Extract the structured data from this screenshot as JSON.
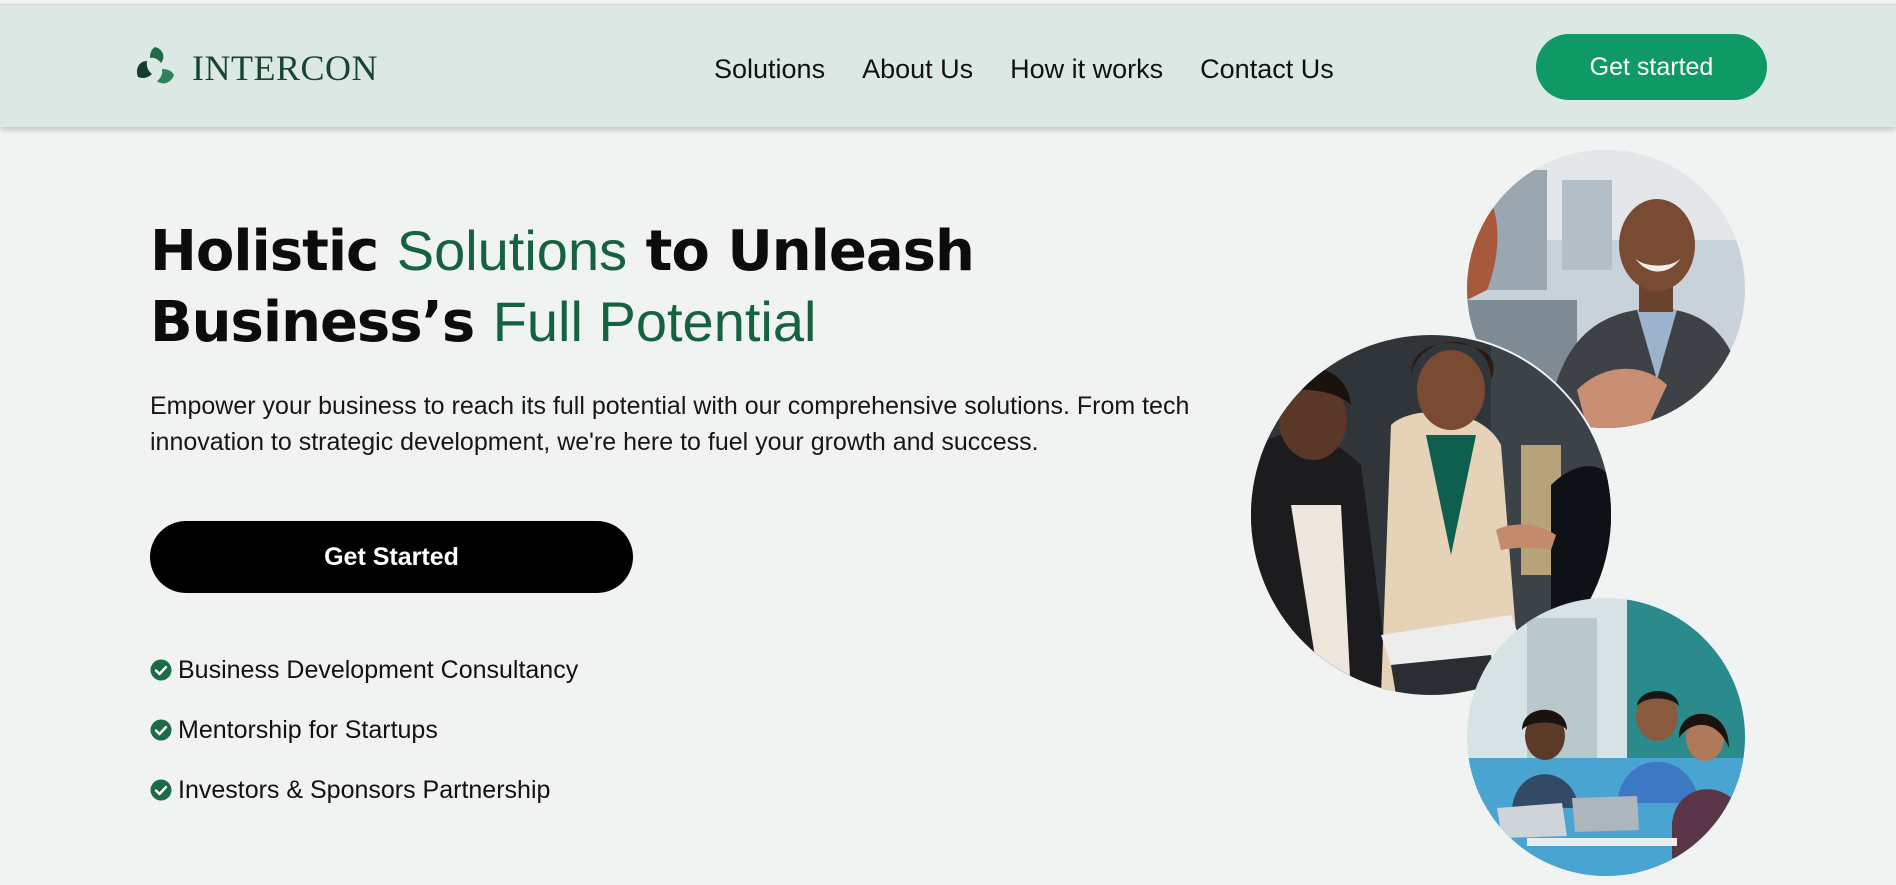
{
  "header": {
    "brand_name": "INTERCON",
    "logo_icon": "recycle-leaf-icon",
    "nav": [
      {
        "label": "Solutions"
      },
      {
        "label": "About Us"
      },
      {
        "label": "How it works"
      },
      {
        "label": "Contact Us"
      }
    ],
    "cta_label": "Get started"
  },
  "hero": {
    "title_part1": "Holistic ",
    "title_highlight1": "Solutions",
    "title_part2": " to Unleash Business’s ",
    "title_highlight2": "Full Potential",
    "description": "Empower your business to reach its full potential with our comprehensive solutions. From tech innovation to strategic development, we're here to fuel your growth and success.",
    "cta_label": "Get Started",
    "features": [
      {
        "label": "Business Development Consultancy",
        "icon": "check-circle-icon"
      },
      {
        "label": "Mentorship for Startups",
        "icon": "check-circle-icon"
      },
      {
        "label": "Investors & Sponsors Partnership",
        "icon": "check-circle-icon"
      }
    ]
  },
  "photos": [
    {
      "name": "smiling-businessman-photo"
    },
    {
      "name": "handshake-meeting-photo"
    },
    {
      "name": "team-laptops-photo"
    }
  ],
  "colors": {
    "brand_green": "#0f9964",
    "headline_green": "#14623f",
    "header_bg": "#dce8e4",
    "page_bg": "#f1f3f2",
    "button_dark": "#000000"
  }
}
